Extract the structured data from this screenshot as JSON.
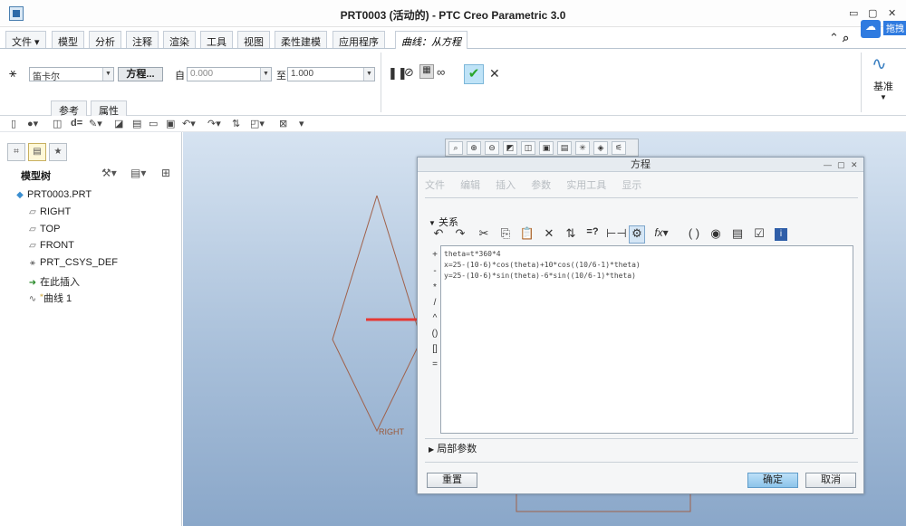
{
  "window": {
    "title": "PRT0003 (活动的) - PTC Creo Parametric 3.0",
    "min": "▭",
    "restore": "▢",
    "close": "✕"
  },
  "tabs": [
    {
      "label": "文件 ▾"
    },
    {
      "label": "模型"
    },
    {
      "label": "分析"
    },
    {
      "label": "注释"
    },
    {
      "label": "渲染"
    },
    {
      "label": "工具"
    },
    {
      "label": "视图"
    },
    {
      "label": "柔性建模"
    },
    {
      "label": "应用程序"
    },
    {
      "label": "曲线：从方程"
    }
  ],
  "cloud": {
    "label": "拖拽"
  },
  "ribbon": {
    "coord_system": "笛卡尔",
    "equation_button": "方程...",
    "from_label": "自",
    "from_value": "0.000",
    "to_label": "至",
    "to_value": "1.000",
    "datum_label": "基准",
    "subtabs": [
      "参考",
      "属性"
    ]
  },
  "tree": {
    "title": "模型树",
    "items": [
      {
        "label": "PRT0003.PRT",
        "icon": "part-icon"
      },
      {
        "label": "RIGHT",
        "icon": "datum-plane-icon"
      },
      {
        "label": "TOP",
        "icon": "datum-plane-icon"
      },
      {
        "label": "FRONT",
        "icon": "datum-plane-icon"
      },
      {
        "label": "PRT_CSYS_DEF",
        "icon": "csys-icon"
      },
      {
        "label": "在此插入",
        "icon": "insert-arrow-icon"
      },
      {
        "label": "曲线 1",
        "icon": "curve-icon"
      }
    ]
  },
  "dialog": {
    "title": "方程",
    "menu": [
      "文件",
      "编辑",
      "插入",
      "参数",
      "实用工具",
      "显示"
    ],
    "relations_header": "关系",
    "operators": [
      "+",
      "-",
      "*",
      "/",
      "^",
      "()",
      "[]",
      "="
    ],
    "equations": [
      "theta=t*360*4",
      "x=25-(10-6)*cos(theta)+10*cos((10/6-1)*theta)",
      "y=25-(10-6)*sin(theta)-6*sin((10/6-1)*theta)"
    ],
    "local_params_header": "局部参数",
    "reset_button": "重置",
    "ok_button": "确定",
    "cancel_button": "取消"
  },
  "graphics": {
    "plane_label": "RIGHT"
  },
  "colors": {
    "arrow": "#e53935",
    "sketch": "#a0614a",
    "ok_check": "#2aa52a"
  }
}
